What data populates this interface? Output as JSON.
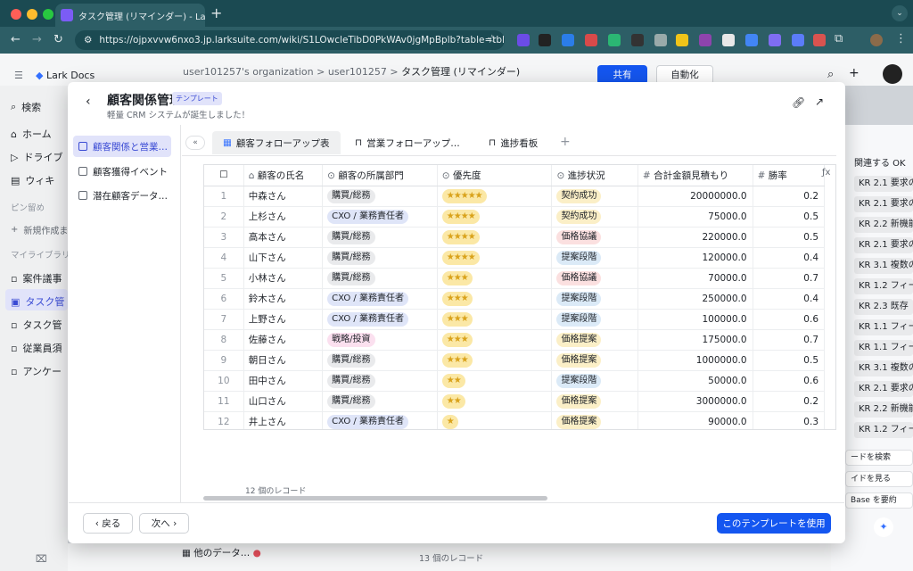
{
  "browser": {
    "tab_title": "タスク管理 (リマインダー) - Lar",
    "url": "https://ojpxvvw6nxo3.jp.larksuite.com/wiki/S1LOwcleTibD0PkWAv0jgMpBplb?table=tbl21..."
  },
  "lark": {
    "app_name": "Lark Docs",
    "breadcrumb": [
      "user101257's organization",
      "user101257",
      "タスク管理 (リマインダー)"
    ],
    "share_label": "共有",
    "automation_label": "自動化",
    "sidebar": {
      "search": "検索",
      "home": "ホーム",
      "drive": "ドライブ",
      "wiki": "ウィキ",
      "pinned": "ピン留め",
      "new": "新規作成ま",
      "library": "マイライブラリ",
      "items": [
        "案件議事",
        "タスク管",
        "タスク管",
        "従業員須",
        "アンケー"
      ]
    },
    "right_panel": {
      "title": "関連する OK",
      "items": [
        "KR 2.1 要求の",
        "KR 2.1 要求の",
        "KR 2.2 新機能",
        "KR 2.1 要求の",
        "KR 3.1 複数の",
        "KR 1.2 フィー",
        "KR 2.3 既存",
        "KR 1.1 フィー",
        "KR 1.1 フィー",
        "KR 3.1 複数の",
        "KR 2.1 要求の",
        "KR 2.2 新機能",
        "KR 1.2 フィー"
      ],
      "search_record": "ードを検索",
      "guide": "イドを見る",
      "summarize": "Base を要約"
    },
    "bottom": {
      "other_data": "他のデータ…",
      "record_count": "13 個のレコード"
    }
  },
  "modal": {
    "title": "顧客関係管理",
    "badge": "テンプレート",
    "subtitle": "軽量 CRM システムが誕生しました！",
    "nav": [
      "顧客関係と営業…",
      "顧客獲得イベント",
      "潜在顧客データ…"
    ],
    "tabs": [
      "顧客フォローアップ表",
      "営業フォローアップ…",
      "進捗看板"
    ],
    "columns": [
      "顧客の氏名",
      "顧客の所属部門",
      "優先度",
      "進捗状況",
      "合計金額見積もり",
      "勝率"
    ],
    "rows": [
      {
        "idx": "1",
        "name": "中森さん",
        "dept": "購買/総務",
        "dept_kind": "dept",
        "stars": "★★★★★",
        "status": "契約成功",
        "status_kind": "win",
        "amount": "20000000.0",
        "rate": "0.2"
      },
      {
        "idx": "2",
        "name": "上杉さん",
        "dept": "CXO / 業務責任者",
        "dept_kind": "cxo",
        "stars": "★★★★",
        "status": "契約成功",
        "status_kind": "win",
        "amount": "75000.0",
        "rate": "0.5"
      },
      {
        "idx": "3",
        "name": "高本さん",
        "dept": "購買/総務",
        "dept_kind": "dept",
        "stars": "★★★★",
        "status": "価格協議",
        "status_kind": "neg",
        "amount": "220000.0",
        "rate": "0.5"
      },
      {
        "idx": "4",
        "name": "山下さん",
        "dept": "購買/総務",
        "dept_kind": "dept",
        "stars": "★★★★",
        "status": "提案段階",
        "status_kind": "prop",
        "amount": "120000.0",
        "rate": "0.4"
      },
      {
        "idx": "5",
        "name": "小林さん",
        "dept": "購買/総務",
        "dept_kind": "dept",
        "stars": "★★★",
        "status": "価格協議",
        "status_kind": "neg",
        "amount": "70000.0",
        "rate": "0.7"
      },
      {
        "idx": "6",
        "name": "鈴木さん",
        "dept": "CXO / 業務責任者",
        "dept_kind": "cxo",
        "stars": "★★★",
        "status": "提案段階",
        "status_kind": "prop",
        "amount": "250000.0",
        "rate": "0.4"
      },
      {
        "idx": "7",
        "name": "上野さん",
        "dept": "CXO / 業務責任者",
        "dept_kind": "cxo",
        "stars": "★★★",
        "status": "提案段階",
        "status_kind": "prop",
        "amount": "100000.0",
        "rate": "0.6"
      },
      {
        "idx": "8",
        "name": "佐藤さん",
        "dept": "戦略/投資",
        "dept_kind": "strat",
        "stars": "★★★",
        "status": "価格提案",
        "status_kind": "price",
        "amount": "175000.0",
        "rate": "0.7"
      },
      {
        "idx": "9",
        "name": "朝日さん",
        "dept": "購買/総務",
        "dept_kind": "dept",
        "stars": "★★★",
        "status": "価格提案",
        "status_kind": "price",
        "amount": "1000000.0",
        "rate": "0.5"
      },
      {
        "idx": "10",
        "name": "田中さん",
        "dept": "購買/総務",
        "dept_kind": "dept",
        "stars": "★★",
        "status": "提案段階",
        "status_kind": "prop",
        "amount": "50000.0",
        "rate": "0.6"
      },
      {
        "idx": "11",
        "name": "山口さん",
        "dept": "購買/総務",
        "dept_kind": "dept",
        "stars": "★★",
        "status": "価格提案",
        "status_kind": "price",
        "amount": "3000000.0",
        "rate": "0.2"
      },
      {
        "idx": "12",
        "name": "井上さん",
        "dept": "CXO / 業務責任者",
        "dept_kind": "cxo",
        "stars": "★",
        "status": "価格提案",
        "status_kind": "price",
        "amount": "90000.0",
        "rate": "0.3"
      }
    ],
    "record_count": "12 個のレコード",
    "back_label": "戻る",
    "next_label": "次へ",
    "use_template_label": "このテンプレートを使用"
  }
}
